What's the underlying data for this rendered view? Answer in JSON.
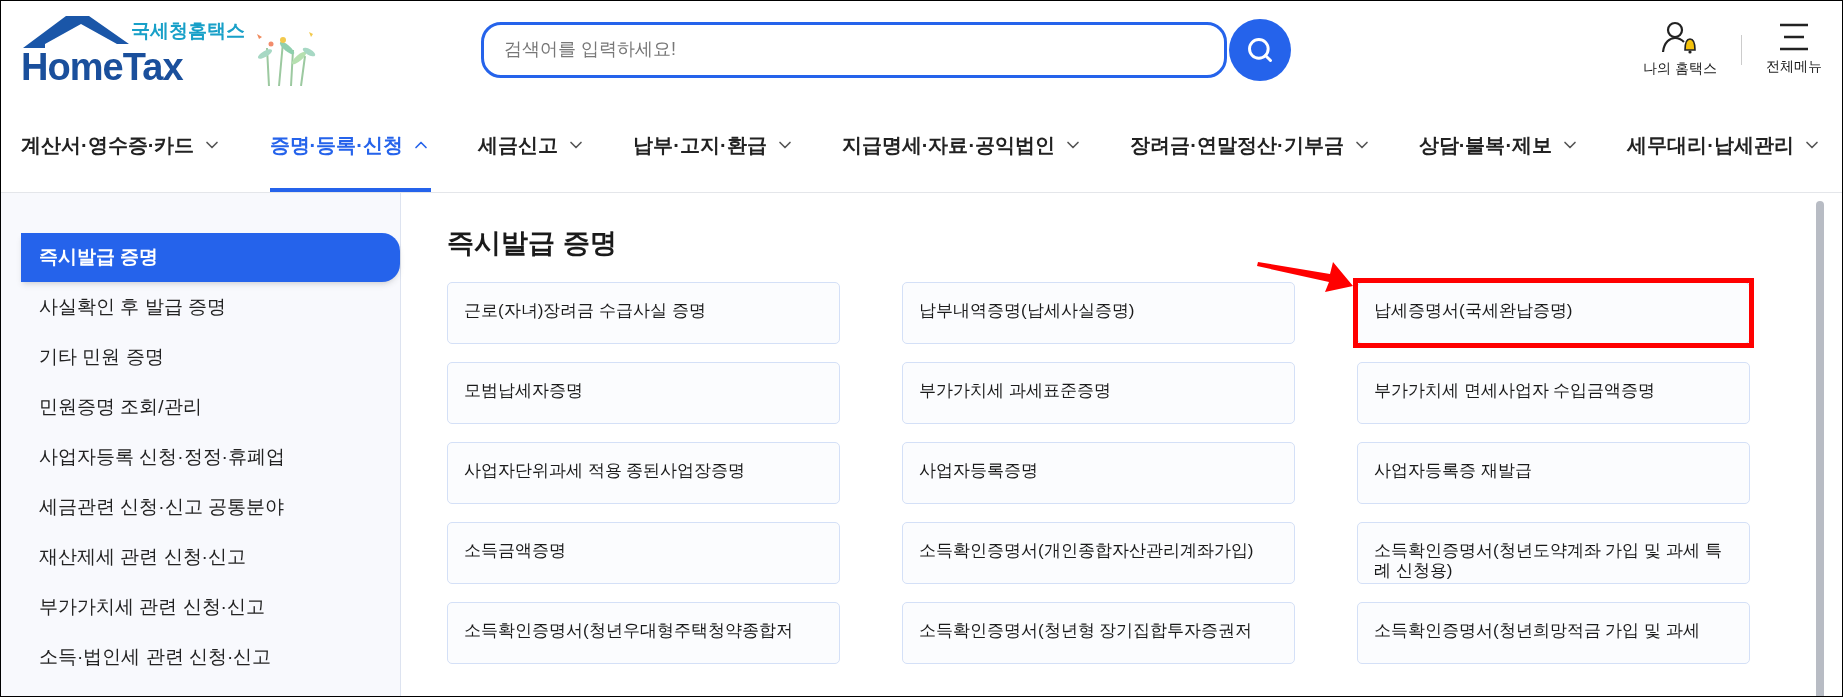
{
  "logo": {
    "caption": "국세청홈택스",
    "wordmark": "HomeTax"
  },
  "search": {
    "placeholder": "검색어를 입력하세요!"
  },
  "header_links": [
    {
      "kind": "my",
      "label": "나의 홈택스"
    },
    {
      "kind": "menu",
      "label": "전체메뉴"
    }
  ],
  "nav": [
    {
      "label": "계산서·영수증·카드",
      "selected": false
    },
    {
      "label": "증명·등록·신청",
      "selected": true
    },
    {
      "label": "세금신고",
      "selected": false
    },
    {
      "label": "납부·고지·환급",
      "selected": false
    },
    {
      "label": "지급명세·자료·공익법인",
      "selected": false
    },
    {
      "label": "장려금·연말정산·기부금",
      "selected": false
    },
    {
      "label": "상담·불복·제보",
      "selected": false
    },
    {
      "label": "세무대리·납세관리",
      "selected": false
    }
  ],
  "sidebar": {
    "items": [
      {
        "label": "즉시발급 증명",
        "selected": true
      },
      {
        "label": "사실확인 후 발급 증명",
        "selected": false
      },
      {
        "label": "기타 민원 증명",
        "selected": false
      },
      {
        "label": "민원증명 조회/관리",
        "selected": false
      },
      {
        "label": "사업자등록 신청·정정·휴폐업",
        "selected": false
      },
      {
        "label": "세금관련 신청·신고 공통분야",
        "selected": false
      },
      {
        "label": "재산제세 관련 신청·신고",
        "selected": false
      },
      {
        "label": "부가가치세 관련 신청·신고",
        "selected": false
      },
      {
        "label": "소득·법인세 관련 신청·신고",
        "selected": false
      }
    ]
  },
  "section": {
    "title": "즉시발급 증명",
    "cards": [
      {
        "label": "근로(자녀)장려금 수급사실 증명",
        "highlighted": false
      },
      {
        "label": "납부내역증명(납세사실증명)",
        "highlighted": false
      },
      {
        "label": "납세증명서(국세완납증명)",
        "highlighted": true
      },
      {
        "label": "모범납세자증명",
        "highlighted": false
      },
      {
        "label": "부가가치세 과세표준증명",
        "highlighted": false
      },
      {
        "label": "부가가치세 면세사업자 수입금액증명",
        "highlighted": false
      },
      {
        "label": "사업자단위과세 적용 종된사업장증명",
        "highlighted": false
      },
      {
        "label": "사업자등록증명",
        "highlighted": false
      },
      {
        "label": "사업자등록증 재발급",
        "highlighted": false
      },
      {
        "label": "소득금액증명",
        "highlighted": false
      },
      {
        "label": "소득확인증명서(개인종합자산관리계좌가입)",
        "highlighted": false
      },
      {
        "label": "소득확인증명서(청년도약계좌 가입 및 과세 특례 신청용)",
        "highlighted": false
      },
      {
        "label": "소득확인증명서(청년우대형주택청약종합저",
        "highlighted": false
      },
      {
        "label": "소득확인증명서(청년형 장기집합투자증권저",
        "highlighted": false
      },
      {
        "label": "소득확인증명서(청년희망적금 가입 및 과세",
        "highlighted": false
      }
    ]
  }
}
